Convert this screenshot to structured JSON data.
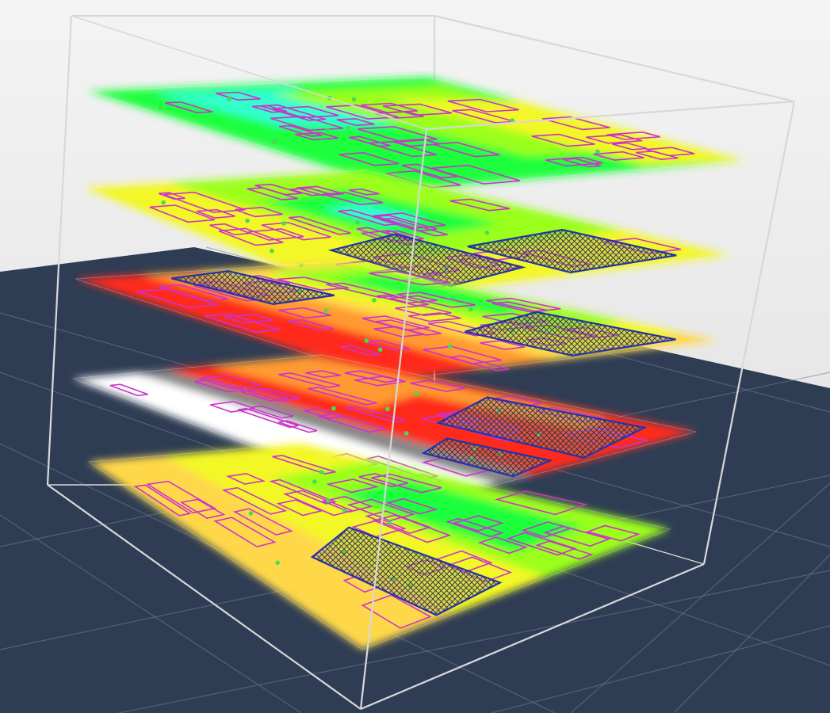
{
  "viewport": {
    "background_top": "#f4f4f4",
    "background_bottom": "#dcdcdc",
    "ground_color": "#2f3d54",
    "grid_color": "#6f7f96",
    "bounding_box_color": "#d8d8d8"
  },
  "heatmap_colors": {
    "strong": "#1bff3c",
    "cyan": "#33ffcc",
    "good": "#9bff1a",
    "medium": "#f3f728",
    "fair": "#ffd84a",
    "weak": "#ff9a32",
    "poor": "#ff2a1a",
    "none": "#888888",
    "no_coverage": "#ffffff"
  },
  "overlay_colors": {
    "room_outline": "#cc33cc",
    "hatched_zone_fill": "#8f8f8f",
    "hatched_zone_border": "#2233aa",
    "access_point": "#44dd55"
  },
  "floors": [
    {
      "id": "floor-5",
      "level": 5,
      "dominant_signal": "strong",
      "zones": [
        "strong",
        "cyan",
        "good",
        "medium"
      ]
    },
    {
      "id": "floor-4",
      "level": 4,
      "dominant_signal": "good",
      "zones": [
        "medium",
        "good",
        "strong",
        "cyan"
      ]
    },
    {
      "id": "floor-3",
      "level": 3,
      "dominant_signal": "weak",
      "zones": [
        "poor",
        "weak",
        "fair",
        "medium",
        "good",
        "strong"
      ]
    },
    {
      "id": "floor-2",
      "level": 2,
      "dominant_signal": "poor",
      "zones": [
        "no_coverage",
        "none",
        "poor",
        "weak",
        "poor"
      ]
    },
    {
      "id": "floor-1",
      "level": 1,
      "dominant_signal": "medium",
      "zones": [
        "medium",
        "fair",
        "good",
        "strong"
      ]
    }
  ]
}
